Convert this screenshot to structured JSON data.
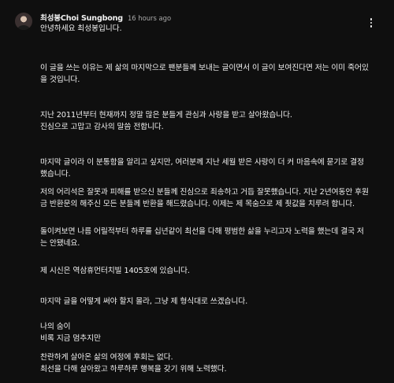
{
  "comment": {
    "author": "최성봉Choi Sungbong",
    "timestamp": "16 hours ago",
    "paragraphs": [
      "안녕하세요 최성봉입니다.",
      "이 글을 쓰는 이유는 제 삶의 마지막으로 팬분들께 보내는 글이면서 이 글이 보여진다면 저는 이미 죽어있을 것입니다.",
      "지난 2011년부터 현재까지 정말 많은 분들게 관심과 사랑을 받고 살아왔습니다.\n진심으로 고맙고 감사의 말씀 전합니다.",
      "마지막 글이라 이 분통함을 알리고 싶지만, 여러분께 지난 세월 받은 사랑이 더 커 마음속에 묻기로 결정했습니다.",
      "저의 어리석은 잘못과 피해를 받으신 분들께 진심으로 죄송하고 거듭 잘못했습니다. 지난 2년여동안 후원금 반환문의 해주신 모든 분들께 반환을 해드렸습니다. 이제는 제 목숨으로 제 죗값을 치루려 합니다.",
      "돌이켜보면 나름 어릴적부터 하루를 십년같이 최선을 다해 평범한 삶을 누리고자 노력을 했는데 결국 저는 안됐네요.",
      "제 시신은 역삼휴먼터치빌 1405호에 있습니다.",
      "마지막 글을 어떻게 써야 할지 몰라, 그냥 제 형식대로 쓰겠습니다.",
      "나의 숨이\n비록 지금 멈추지만",
      "찬란하게 살아온 삶의 여정에 후회는 없다.\n최선을 다해 살아왔고 하루하루 행복을 갖기 위해 노력했다."
    ]
  }
}
